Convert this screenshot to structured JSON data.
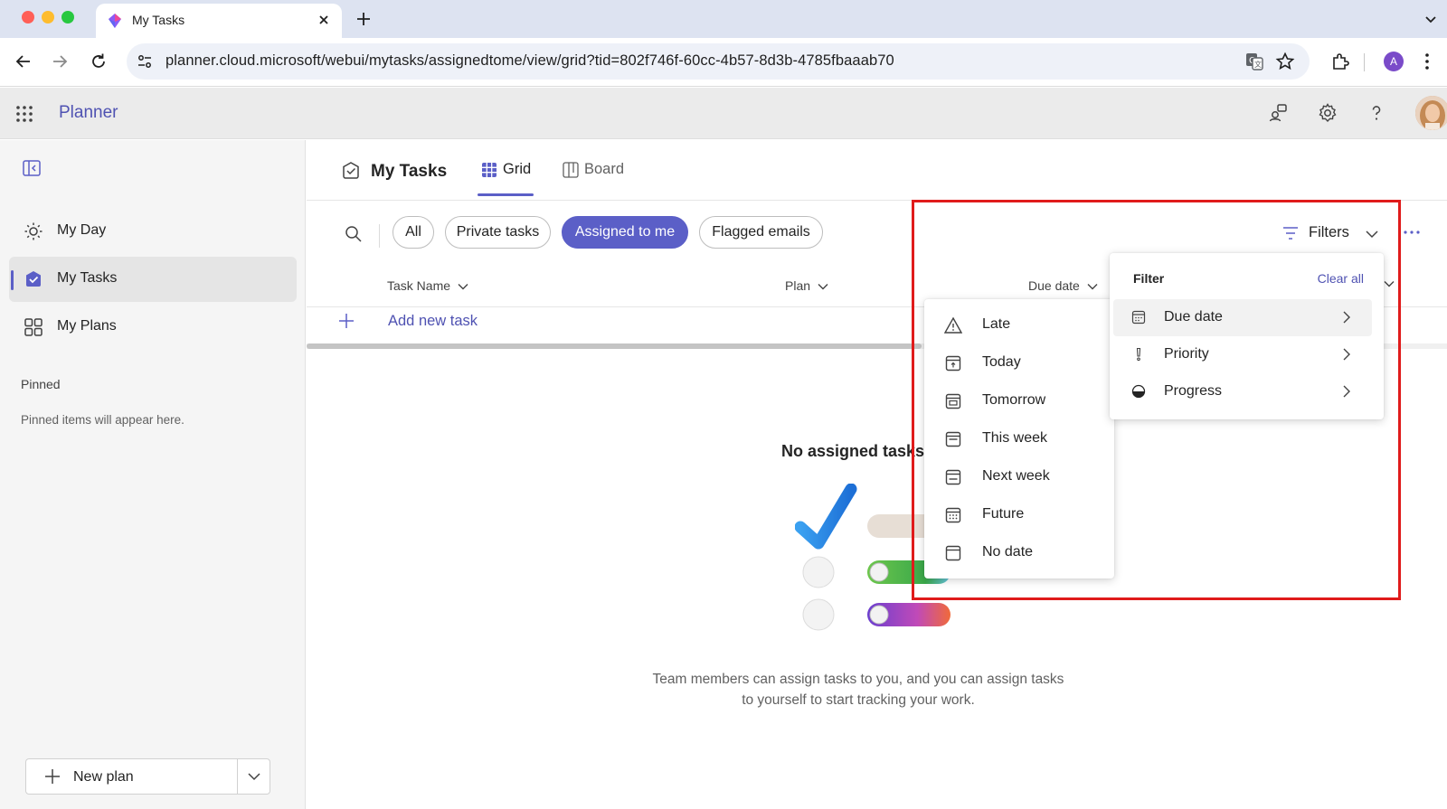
{
  "browser": {
    "tab_title": "My Tasks",
    "url": "planner.cloud.microsoft/webui/mytasks/assignedtome/view/grid?tid=802f746f-60cc-4b57-8d3b-4785fbaaab70",
    "profile_initial": "A"
  },
  "app": {
    "name": "Planner"
  },
  "sidebar": {
    "items": [
      {
        "label": "My Day",
        "icon": "sun-icon"
      },
      {
        "label": "My Tasks",
        "icon": "task-check-icon"
      },
      {
        "label": "My Plans",
        "icon": "grid-plans-icon"
      }
    ],
    "pinned_heading": "Pinned",
    "pinned_empty": "Pinned items will appear here.",
    "new_plan_label": "New plan"
  },
  "main": {
    "title": "My Tasks",
    "view_tabs": [
      {
        "label": "Grid",
        "active": true
      },
      {
        "label": "Board",
        "active": false
      }
    ],
    "pills": [
      {
        "label": "All",
        "selected": false
      },
      {
        "label": "Private tasks",
        "selected": false
      },
      {
        "label": "Assigned to me",
        "selected": true
      },
      {
        "label": "Flagged emails",
        "selected": false
      }
    ],
    "filters_label": "Filters",
    "columns": [
      "Task Name",
      "Plan",
      "Due date"
    ],
    "add_task_label": "Add new task",
    "empty_title": "No assigned tasks",
    "empty_desc": "Team members can assign tasks to you, and you can assign tasks to yourself to start tracking your work."
  },
  "filter_panel": {
    "heading": "Filter",
    "clear_all": "Clear all",
    "items": [
      {
        "label": "Due date",
        "icon": "calendar-icon"
      },
      {
        "label": "Priority",
        "icon": "priority-icon"
      },
      {
        "label": "Progress",
        "icon": "progress-half-icon"
      }
    ]
  },
  "due_date_menu": {
    "items": [
      {
        "label": "Late",
        "icon": "warning-icon"
      },
      {
        "label": "Today",
        "icon": "calendar-today-icon"
      },
      {
        "label": "Tomorrow",
        "icon": "calendar-tomorrow-icon"
      },
      {
        "label": "This week",
        "icon": "calendar-week-icon"
      },
      {
        "label": "Next week",
        "icon": "calendar-next-week-icon"
      },
      {
        "label": "Future",
        "icon": "calendar-future-icon"
      },
      {
        "label": "No date",
        "icon": "calendar-empty-icon"
      }
    ]
  },
  "colors": {
    "accent": "#5b5fc7",
    "accent_text": "#4f52b2",
    "annotation": "#e01b1b",
    "header_bg": "#ebebeb",
    "sidebar_bg": "#f5f5f5"
  }
}
